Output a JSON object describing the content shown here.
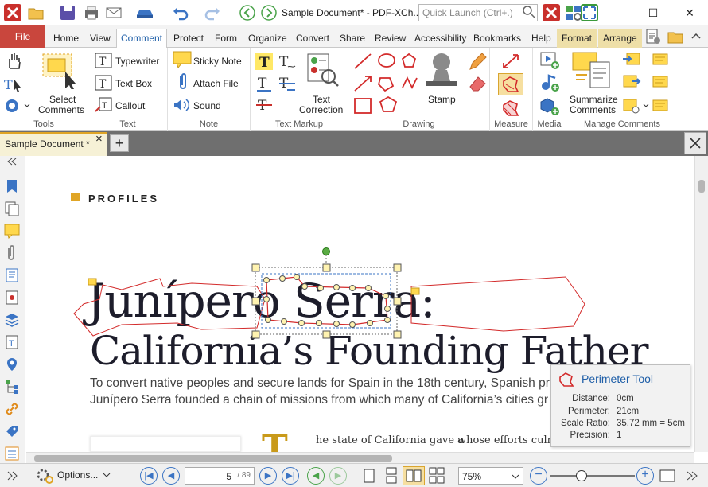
{
  "window": {
    "title": "Sample Document* - PDF-XCh..",
    "search_placeholder": "Quick Launch (Ctrl+.)",
    "minimize": "—",
    "maximize": "☐",
    "close": "✕"
  },
  "tabs": [
    {
      "label": "File"
    },
    {
      "label": "Home"
    },
    {
      "label": "View"
    },
    {
      "label": "Comment"
    },
    {
      "label": "Protect"
    },
    {
      "label": "Form"
    },
    {
      "label": "Organize"
    },
    {
      "label": "Convert"
    },
    {
      "label": "Share"
    },
    {
      "label": "Review"
    },
    {
      "label": "Accessibility"
    },
    {
      "label": "Bookmarks"
    },
    {
      "label": "Help"
    },
    {
      "label": "Format"
    },
    {
      "label": "Arrange"
    }
  ],
  "ribbon": {
    "tools": {
      "label": "Tools",
      "select_comments": "Select",
      "select_comments2": "Comments"
    },
    "text": {
      "label": "Text",
      "typewriter": "Typewriter",
      "textbox": "Text Box",
      "callout": "Callout"
    },
    "note": {
      "label": "Note",
      "sticky": "Sticky Note",
      "attach": "Attach File",
      "sound": "Sound"
    },
    "markup": {
      "label": "Text Markup",
      "correction": "Text",
      "correction2": "Correction"
    },
    "drawing": {
      "label": "Drawing",
      "stamp": "Stamp"
    },
    "measure": {
      "label": "Measure"
    },
    "media": {
      "label": "Media"
    },
    "manage": {
      "label": "Manage Comments",
      "summarize": "Summarize",
      "summarize2": "Comments"
    }
  },
  "doc_tab": {
    "label": "Sample Document *",
    "close": "×",
    "add": "+"
  },
  "document": {
    "section": "PROFILES",
    "heading1": "Junípero Serra:",
    "heading2": "California’s Founding Father",
    "intro1": "To convert native peoples and secure lands for Spain in the 18th century, Spanish pr",
    "intro2": "Junípero Serra founded a chain of missions from which many of California’s cities gr",
    "dropcap": "T",
    "col1": "he state of California gave a",
    "col2": "whose efforts culmi"
  },
  "tooltip": {
    "title": "Perimeter Tool",
    "rows": [
      {
        "k": "Distance:",
        "v": "0cm"
      },
      {
        "k": "Perimeter:",
        "v": "21cm"
      },
      {
        "k": "Scale Ratio:",
        "v": "35.72 mm = 5cm"
      },
      {
        "k": "Precision:",
        "v": "1"
      }
    ]
  },
  "status": {
    "options": "Options...",
    "page": "5",
    "page_total": "/ 89",
    "zoom": "75%"
  },
  "colors": {
    "accent": "#1f5fa8",
    "file_tab": "#c9463d",
    "annotation": "#d32b2b",
    "highlight": "#e0a526"
  }
}
